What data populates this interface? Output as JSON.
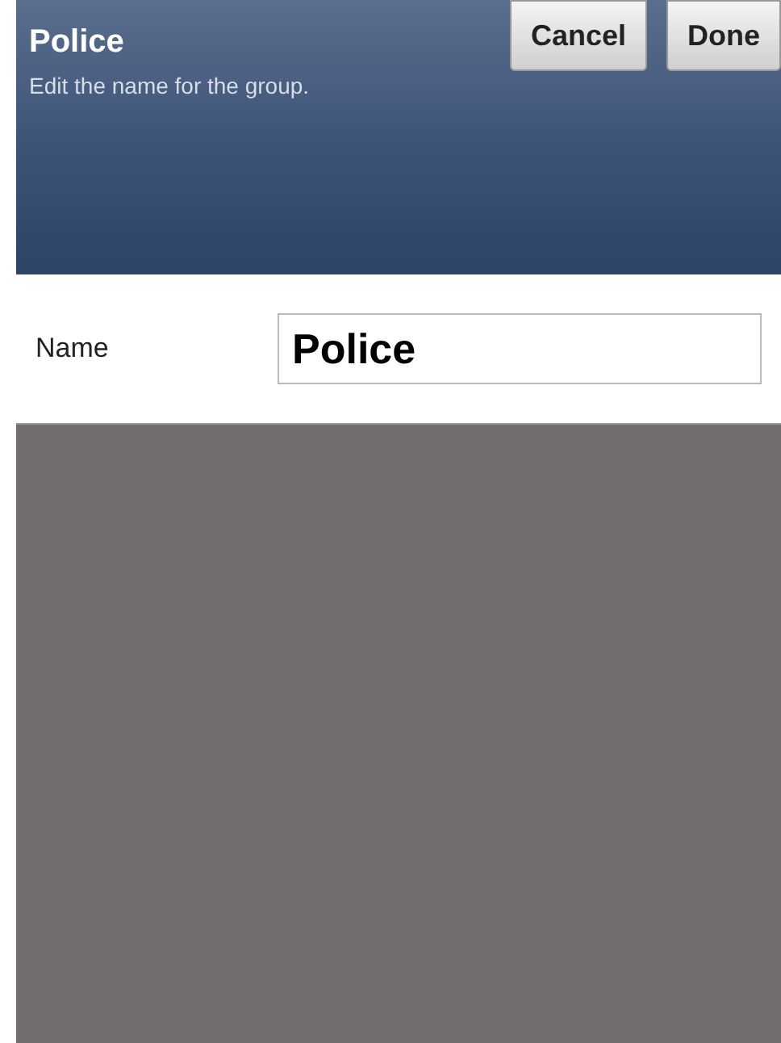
{
  "header": {
    "title": "Police",
    "subtitle": "Edit the name for the group."
  },
  "buttons": [
    {
      "label": "Cancel"
    },
    {
      "label": "Done"
    }
  ],
  "name_field": {
    "label": "Name",
    "value": "Police"
  }
}
